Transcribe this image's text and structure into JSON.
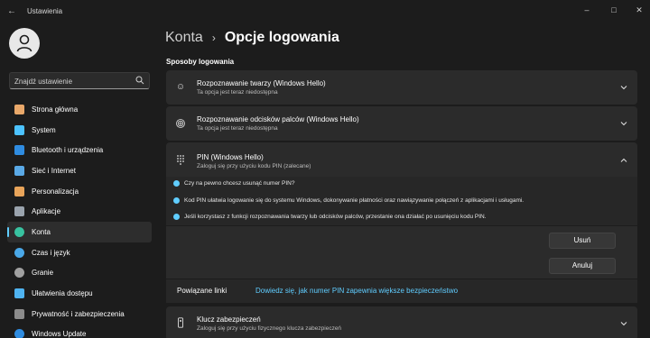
{
  "window": {
    "title": "Ustawienia"
  },
  "search": {
    "placeholder": "Znajdź ustawienie"
  },
  "sidebar": {
    "items": [
      {
        "label": "Strona główna",
        "icon": "home-icon",
        "color": "#e9a86a"
      },
      {
        "label": "System",
        "icon": "system-icon",
        "color": "#4cc2ff"
      },
      {
        "label": "Bluetooth i urządzenia",
        "icon": "bluetooth-icon",
        "color": "#2f8ce0"
      },
      {
        "label": "Sieć i Internet",
        "icon": "wifi-icon",
        "color": "#5aa9e6"
      },
      {
        "label": "Personalizacja",
        "icon": "brush-icon",
        "color": "#e8a45a"
      },
      {
        "label": "Aplikacje",
        "icon": "apps-icon",
        "color": "#9aa3ad"
      },
      {
        "label": "Konta",
        "icon": "account-icon",
        "color": "#38c2a0",
        "active": true
      },
      {
        "label": "Czas i język",
        "icon": "time-language-icon",
        "color": "#4aa8e8"
      },
      {
        "label": "Granie",
        "icon": "gaming-icon",
        "color": "#a0a0a0"
      },
      {
        "label": "Ułatwienia dostępu",
        "icon": "accessibility-icon",
        "color": "#4fb3f0"
      },
      {
        "label": "Prywatność i zabezpieczenia",
        "icon": "shield-icon",
        "color": "#8c8c8c"
      },
      {
        "label": "Windows Update",
        "icon": "update-icon",
        "color": "#2f8ce0"
      }
    ]
  },
  "header": {
    "parent": "Konta",
    "current": "Opcje logowania"
  },
  "main": {
    "section_title": "Sposoby logowania",
    "methods": [
      {
        "title": "Rozpoznawanie twarzy (Windows Hello)",
        "subtitle": "Ta opcja jest teraz niedostępna",
        "icon": "face-icon",
        "expanded": false
      },
      {
        "title": "Rozpoznawanie odcisków palców (Windows Hello)",
        "subtitle": "Ta opcja jest teraz niedostępna",
        "icon": "fingerprint-icon",
        "expanded": false
      },
      {
        "title": "PIN (Windows Hello)",
        "subtitle": "Zaloguj się przy użyciu kodu PIN (zalecane)",
        "icon": "pin-keypad-icon",
        "expanded": true
      },
      {
        "title": "Klucz zabezpieczeń",
        "subtitle": "Zaloguj się przy użyciu fizycznego klucza zabezpieczeń",
        "icon": "key-icon",
        "expanded": false
      }
    ],
    "pin_panel": {
      "info": [
        "Czy na pewno chcesz usunąć numer PIN?",
        "Kod PIN ułatwia logowanie się do systemu Windows, dokonywanie płatności oraz nawiązywanie połączeń z aplikacjami i usługami.",
        "Jeśli korzystasz z funkcji rozpoznawania twarzy lub odcisków palców, przestanie ona działać po usunięciu kodu PIN."
      ],
      "remove_label": "Usuń",
      "cancel_label": "Anuluj",
      "related_label": "Powiązane linki",
      "related_link": "Dowiedz się, jak numer PIN zapewnia większe bezpieczeństwo"
    }
  },
  "colors": {
    "accent": "#60cdff",
    "background": "#1c1c1c",
    "card": "#2b2b2b"
  }
}
